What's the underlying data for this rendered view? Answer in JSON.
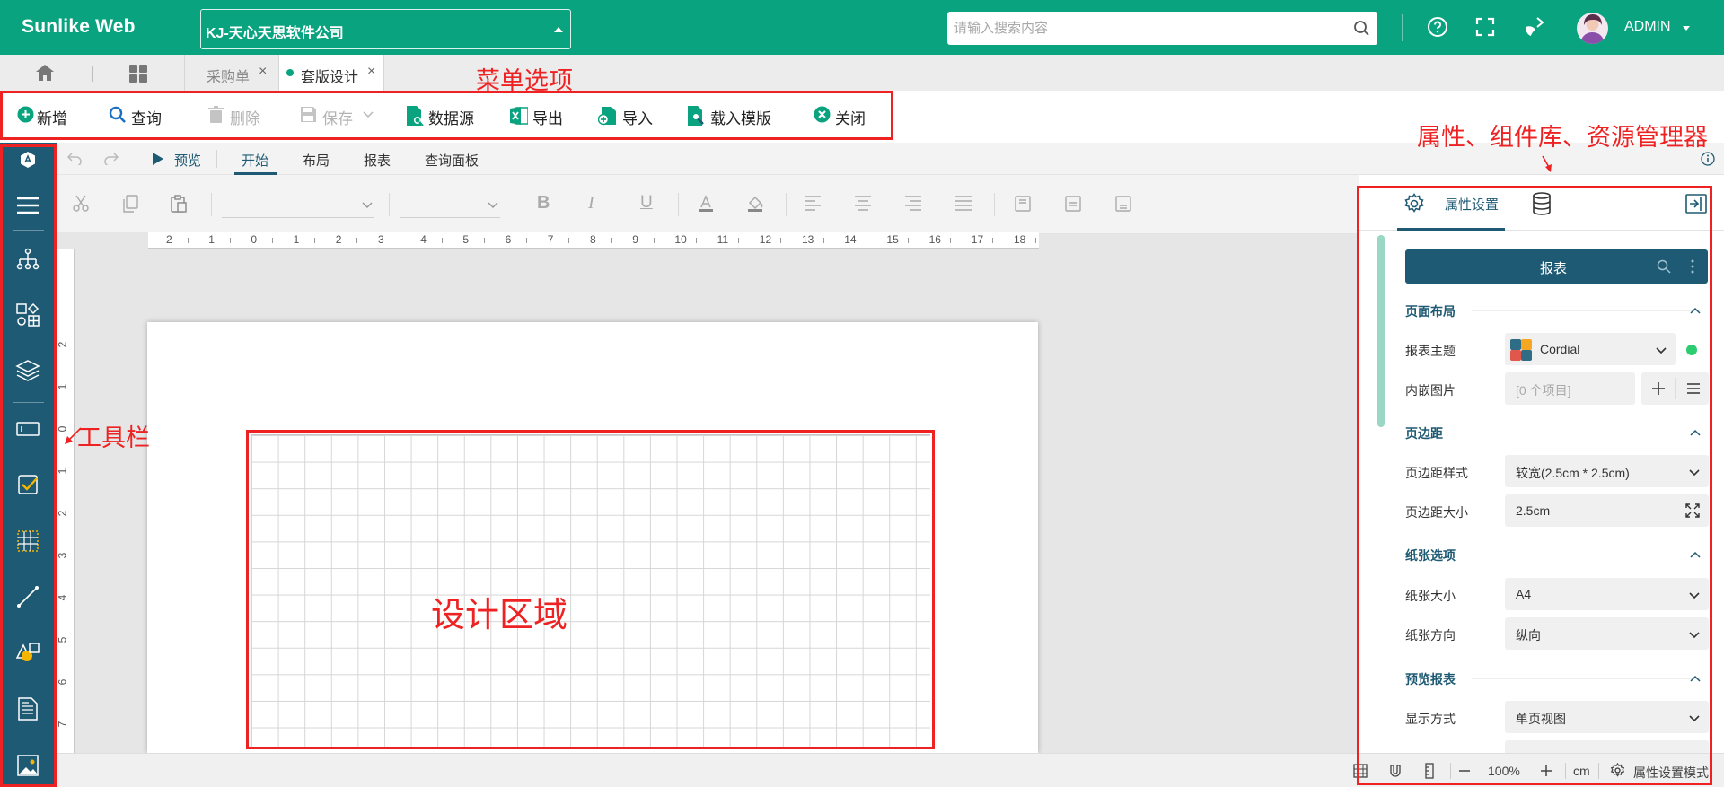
{
  "header": {
    "logo": "Sunlike Web",
    "company": "KJ-天心天思软件公司",
    "search_placeholder": "请输入搜索内容",
    "user": "ADMIN"
  },
  "tabs": [
    {
      "label": "采购单",
      "active": false
    },
    {
      "label": "套版设计",
      "active": true
    }
  ],
  "toolbar": {
    "buttons": [
      {
        "label": "新增",
        "icon": "plus-circle-icon",
        "enabled": true
      },
      {
        "label": "查询",
        "icon": "search-icon",
        "enabled": true
      },
      {
        "label": "删除",
        "icon": "trash-icon",
        "enabled": false
      },
      {
        "label": "保存",
        "icon": "save-icon",
        "enabled": false
      },
      {
        "label": "数据源",
        "icon": "datasource-icon",
        "enabled": true
      },
      {
        "label": "导出",
        "icon": "excel-icon",
        "enabled": true
      },
      {
        "label": "导入",
        "icon": "import-icon",
        "enabled": true
      },
      {
        "label": "载入模版",
        "icon": "template-icon",
        "enabled": true
      },
      {
        "label": "关闭",
        "icon": "close-circle-icon",
        "enabled": true
      }
    ]
  },
  "annotations": {
    "menu": "菜单选项",
    "props": "属性、组件库、资源管理器",
    "toolbar": "工具栏",
    "design": "设计区域"
  },
  "designer": {
    "preview": "预览",
    "tabs": [
      "开始",
      "布局",
      "报表",
      "查询面板"
    ],
    "active_tab": "开始"
  },
  "ruler": {
    "h_marks": [
      "2",
      "1",
      "0",
      "1",
      "2",
      "3",
      "4",
      "5",
      "6",
      "7",
      "8",
      "9",
      "10",
      "11",
      "12",
      "13",
      "14",
      "15",
      "16",
      "17",
      "18"
    ],
    "v_marks": [
      "2",
      "1",
      "0",
      "1",
      "2",
      "3",
      "4",
      "5",
      "6",
      "7"
    ]
  },
  "status": {
    "zoom": "100%",
    "unit": "cm",
    "mode": "属性设置模式"
  },
  "panel": {
    "tab_label": "属性设置",
    "header": "报表",
    "sections": {
      "page_layout": "页面布局",
      "margins": "页边距",
      "paper": "纸张选项",
      "preview": "预览报表"
    },
    "fields": {
      "theme_label": "报表主题",
      "theme_value": "Cordial",
      "images_label": "内嵌图片",
      "images_value": "[0 个项目]",
      "margin_style_label": "页边距样式",
      "margin_style_value": "较宽(2.5cm * 2.5cm)",
      "margin_size_label": "页边距大小",
      "margin_size_value": "2.5cm",
      "paper_size_label": "纸张大小",
      "paper_size_value": "A4",
      "orientation_label": "纸张方向",
      "orientation_value": "纵向",
      "display_label": "显示方式",
      "display_value": "单页视图"
    }
  },
  "colors": {
    "brand": "#0aa37f",
    "sidebar": "#1e5a73",
    "annotation": "#ee2222"
  }
}
